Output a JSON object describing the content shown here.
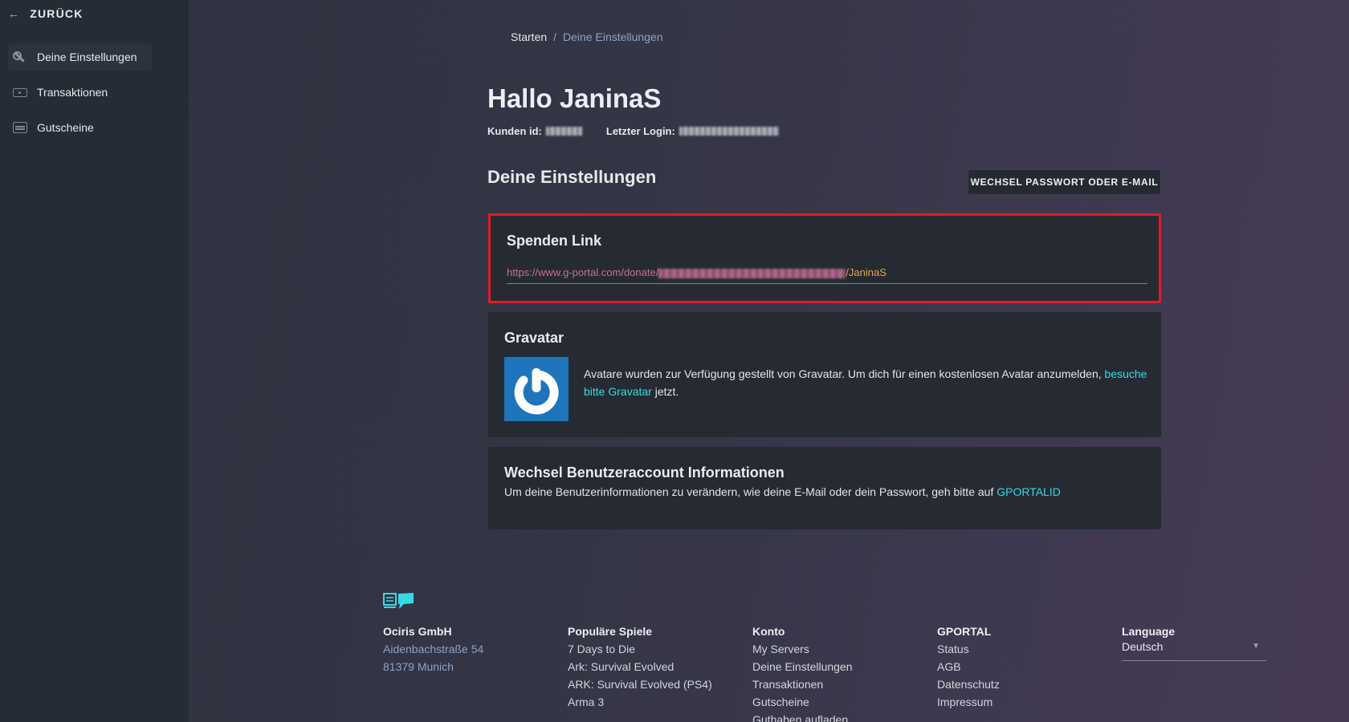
{
  "sidebar": {
    "back_label": "ZURÜCK",
    "items": [
      {
        "label": "Deine Einstellungen",
        "icon": "wrench-icon",
        "active": true
      },
      {
        "label": "Transaktionen",
        "icon": "money-icon",
        "active": false
      },
      {
        "label": "Gutscheine",
        "icon": "voucher-icon",
        "active": false
      }
    ]
  },
  "breadcrumb": {
    "home": "Starten",
    "separator": "/",
    "current": "Deine Einstellungen"
  },
  "header": {
    "greeting": "Hallo JaninaS",
    "customer_id_label": "Kunden id:",
    "last_login_label": "Letzter Login:"
  },
  "settings": {
    "title": "Deine Einstellungen",
    "change_button": "WECHSEL PASSWORT ODER E-MAIL"
  },
  "donate": {
    "title": "Spenden Link",
    "url_prefix": "https://www.g-portal.com/donate/",
    "url_suffix": "/JaninaS"
  },
  "gravatar": {
    "title": "Gravatar",
    "text_before": "Avatare wurden zur Verfügung gestellt von Gravatar. Um dich für einen kostenlosen Avatar anzumelden, ",
    "link": "besuche bitte Gravatar",
    "text_after": " jetzt."
  },
  "account": {
    "title": "Wechsel Benutzeraccount Informationen",
    "text": "Um deine Benutzerinformationen zu verändern, wie deine E-Mail oder dein Passwort, geh bitte auf ",
    "link": "GPORTALID"
  },
  "footer": {
    "company": {
      "name": "Ociris GmbH",
      "street": "Aidenbachstraße 54",
      "city": "81379 Munich"
    },
    "games": {
      "title": "Populäre Spiele",
      "items": [
        "7 Days to Die",
        "Ark: Survival Evolved",
        "ARK: Survival Evolved (PS4)",
        "Arma 3"
      ]
    },
    "account": {
      "title": "Konto",
      "items": [
        "My Servers",
        "Deine Einstellungen",
        "Transaktionen",
        "Gutscheine",
        "Guthaben aufladen"
      ]
    },
    "gportal": {
      "title": "GPORTAL",
      "items": [
        "Status",
        "AGB",
        "Datenschutz",
        "Impressum"
      ]
    },
    "language": {
      "title": "Language",
      "selected": "Deutsch"
    }
  },
  "colors": {
    "accent_cyan": "#38d9e3",
    "highlight_red": "#e01b27",
    "gravatar_blue": "#1e75bb"
  }
}
